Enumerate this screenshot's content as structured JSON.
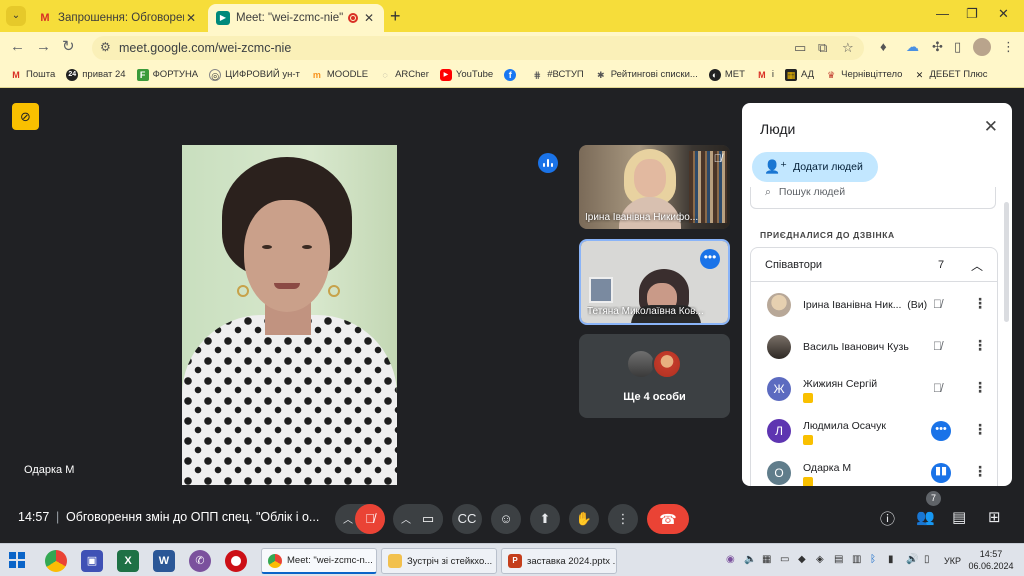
{
  "browser": {
    "tabs": [
      {
        "title": "Запрошення: Обговорення зм",
        "favicon": "gmail-icon",
        "active": false
      },
      {
        "title": "Meet: \"wei-zcmc-nie\"",
        "favicon": "meet-icon",
        "active": true,
        "recording": true
      }
    ],
    "url": "meet.google.com/wei-zcmc-nie",
    "bookmarks": [
      "Пошта",
      "приват 24",
      "ФОРТУНА",
      "ЦИФРОВИЙ ун-т",
      "MOODLE",
      "ARCher",
      "YouTube",
      "",
      "#ВСТУП",
      "Рейтингові списки...",
      "МЕТ",
      "і",
      "АД",
      "Чернівціттело",
      "ДЕБЕТ Плюс"
    ]
  },
  "meet": {
    "main_speaker": {
      "name": "Одарка М"
    },
    "tiles": [
      {
        "name": "Ірина Іванівна Никифо...",
        "muted": true
      },
      {
        "name": "Тетяна Миколаївна Ков...",
        "pinned_options": true
      },
      {
        "more_label": "Ще 4 особи"
      }
    ],
    "people_panel": {
      "title": "Люди",
      "add_people": "Додати людей",
      "search_placeholder": "Пошук людей",
      "section": "ПРИЄДНАЛИСЯ ДО ДЗВІНКА",
      "group_label": "Співавтори",
      "group_count": "7",
      "participants": [
        {
          "name": "Ірина Іванівна Ник...",
          "suffix": "(Ви)",
          "initial": "",
          "avatar_color": "#c9b8a6",
          "status": "muted"
        },
        {
          "name": "Василь Іванович Кузь",
          "suffix": "",
          "initial": "",
          "avatar_color": "#5a4f48",
          "status": "muted"
        },
        {
          "name": "Жижиян Сергій",
          "suffix": "",
          "initial": "Ж",
          "avatar_color": "#5c6bc0",
          "status": "muted"
        },
        {
          "name": "Людмила Осачук",
          "suffix": "",
          "initial": "Л",
          "avatar_color": "#5e35b1",
          "status": "options"
        },
        {
          "name": "Одарка М",
          "suffix": "",
          "initial": "О",
          "avatar_color": "#607d8b",
          "status": "speaking"
        }
      ]
    },
    "bottom_bar": {
      "time": "14:57",
      "separator": "|",
      "meeting_title": "Обговорення змін до ОПП спец. \"Облік і о...",
      "people_count": "7"
    }
  },
  "taskbar": {
    "windows": [
      {
        "title": "Meet: \"wei-zcmc-n...",
        "icon": "chrome-icon",
        "active": true
      },
      {
        "title": "Зустріч зі стейкхо...",
        "icon": "folder-icon",
        "active": false
      },
      {
        "title": "заставка 2024.pptx ...",
        "icon": "powerpoint-icon",
        "active": false
      }
    ],
    "lang": "УКР",
    "time": "14:57",
    "date": "06.06.2024"
  }
}
